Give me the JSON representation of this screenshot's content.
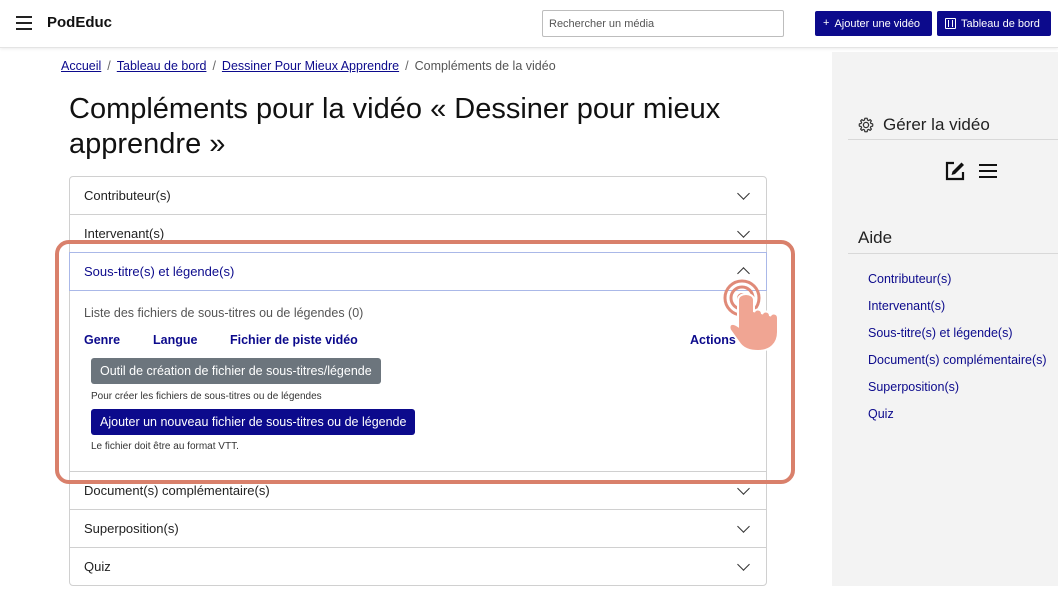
{
  "header": {
    "brand": "PodEduc",
    "search_placeholder": "Rechercher un média",
    "add_video_label": "Ajouter une vidéo",
    "dashboard_label": "Tableau de bord"
  },
  "breadcrumb": {
    "home": "Accueil",
    "dashboard": "Tableau de bord",
    "video": "Dessiner Pour Mieux Apprendre",
    "current": "Compléments de la vidéo",
    "separator": "/"
  },
  "page": {
    "title": "Compléments pour la vidéo « Dessiner pour mieux apprendre »"
  },
  "accordion": {
    "contributors": "Contributeur(s)",
    "speakers": "Intervenant(s)",
    "subtitles": "Sous-titre(s) et légende(s)",
    "documents": "Document(s) complémentaire(s)",
    "overlay": "Superposition(s)",
    "quiz": "Quiz"
  },
  "subtitles_panel": {
    "list_label": "Liste des fichiers de sous-titres ou de légendes (0)",
    "columns": {
      "genre": "Genre",
      "language": "Langue",
      "file": "Fichier de piste vidéo",
      "actions": "Actions"
    },
    "tool_button": "Outil de création de fichier de sous-titres/légende",
    "tool_hint": "Pour créer les fichiers de sous-titres ou de légendes",
    "add_button": "Ajouter un nouveau fichier de sous-titres ou de légende",
    "add_hint": "Le fichier doit être au format VTT."
  },
  "sidebar": {
    "manage_title": "Gérer la vidéo",
    "help_title": "Aide",
    "help_links": [
      "Contributeur(s)",
      "Intervenant(s)",
      "Sous-titre(s) et légende(s)",
      "Document(s) complémentaire(s)",
      "Superposition(s)",
      "Quiz"
    ]
  },
  "colors": {
    "primary": "#0c0a8c",
    "secondary_button": "#6c757d",
    "highlight": "#d9806b",
    "sidebar_bg": "#f3f3f3"
  },
  "icons": [
    "menu-icon",
    "plus-icon",
    "film-icon",
    "chevron-down-icon",
    "chevron-up-icon",
    "gear-icon",
    "edit-icon",
    "list-icon",
    "tap-hand-icon"
  ]
}
